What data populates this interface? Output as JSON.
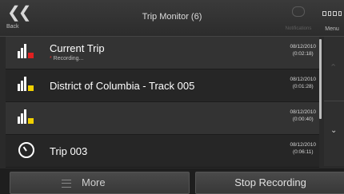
{
  "header": {
    "title": "Trip Monitor (6)",
    "back_label": "Back",
    "back_icon": "double-chevron-left-icon",
    "notifications_label": "Notifications",
    "menu_label": "Menu"
  },
  "trips": [
    {
      "name": "Current Trip",
      "sub": "Recording...",
      "date": "08/12/2010",
      "duration": "(0:02:18)",
      "icon": "track-bars-icon",
      "status_color": "#e02020"
    },
    {
      "name": "District of Columbia - Track 005",
      "sub": "",
      "date": "08/12/2010",
      "duration": "(0:01:28)",
      "icon": "track-bars-icon",
      "status_color": "#f0d000"
    },
    {
      "name": "",
      "sub": "",
      "date": "08/12/2010",
      "duration": "(0:00:40)",
      "icon": "track-bars-icon",
      "status_color": "#f0d000"
    },
    {
      "name": "Trip 003",
      "sub": "",
      "date": "08/12/2010",
      "duration": "(0:06:11)",
      "icon": "timer-icon",
      "status_color": ""
    }
  ],
  "side": {
    "up_icon": "chevron-up-icon",
    "down_icon": "chevron-down-icon"
  },
  "footer": {
    "more_label": "More",
    "stop_label": "Stop Recording"
  }
}
